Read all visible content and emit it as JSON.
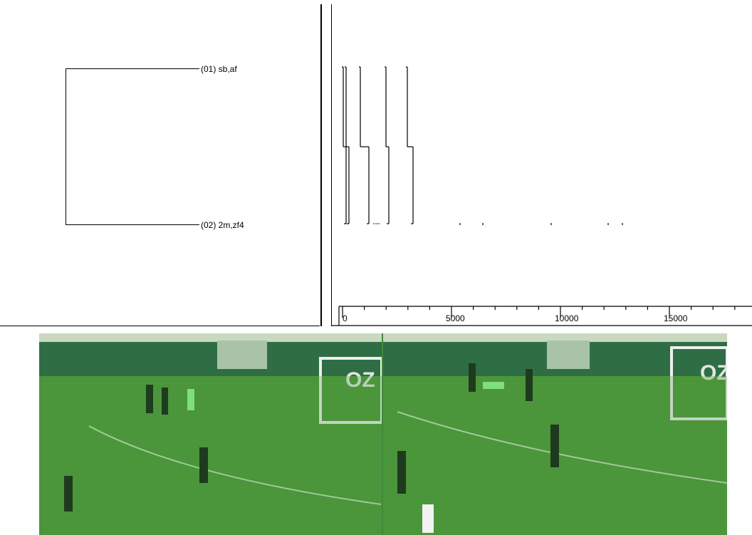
{
  "tree": {
    "leaves": [
      {
        "id": "leaf-01",
        "label": "(01) sb,af"
      },
      {
        "id": "leaf-02",
        "label": "(02) 2m,zf4"
      }
    ]
  },
  "track": {
    "axis_ticks": [
      "0",
      "5000",
      "10000",
      "15000"
    ]
  },
  "colors": {
    "line": "#000000",
    "grass": "#4f9a3c",
    "grass_dark": "#3f8838",
    "fence": "#2f6e44",
    "sky": "#c9d9c0"
  },
  "video": {
    "frames": [
      "frame-left",
      "frame-right"
    ]
  }
}
